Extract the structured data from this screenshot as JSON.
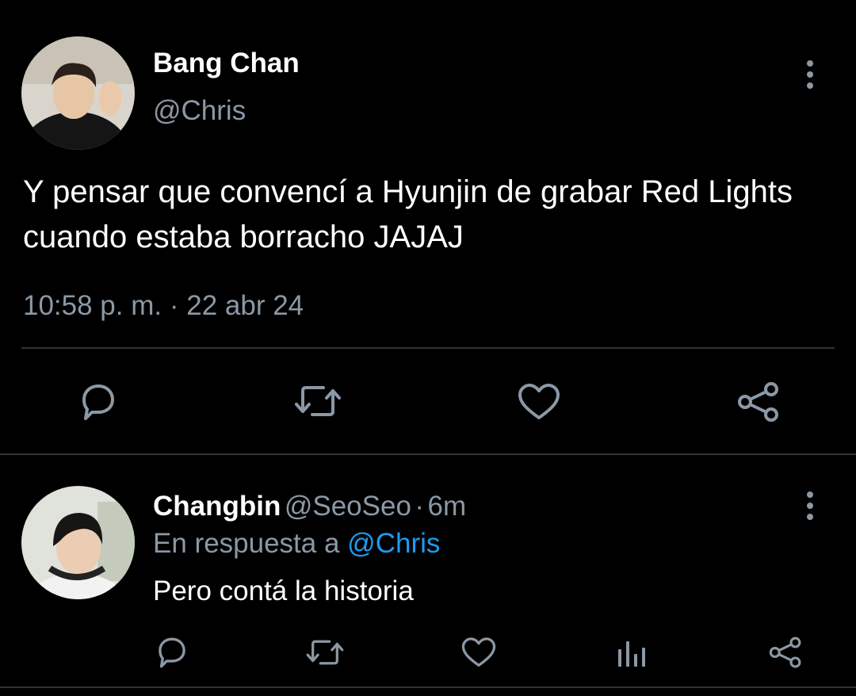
{
  "main_tweet": {
    "display_name": "Bang Chan",
    "handle": "@Chris",
    "text": "Y pensar que convencí a Hyunjin de grabar Red Lights cuando estaba borracho JAJAJ",
    "time": "10:58 p. m.",
    "separator": "·",
    "date": "22 abr 24",
    "actions": [
      "reply-icon",
      "retweet-icon",
      "like-icon",
      "share-icon"
    ]
  },
  "reply": {
    "display_name": "Changbin",
    "handle": "@SeoSeo",
    "separator": "·",
    "age": "6m",
    "replying_prefix": "En respuesta a",
    "replying_to": "@Chris",
    "text": "Pero contá la historia",
    "actions": [
      "reply-icon",
      "retweet-icon",
      "like-icon",
      "analytics-icon",
      "share-icon"
    ]
  },
  "colors": {
    "background": "#000000",
    "secondary_text": "#8b98a5",
    "link": "#1d9bf0",
    "divider": "#2f3336"
  }
}
